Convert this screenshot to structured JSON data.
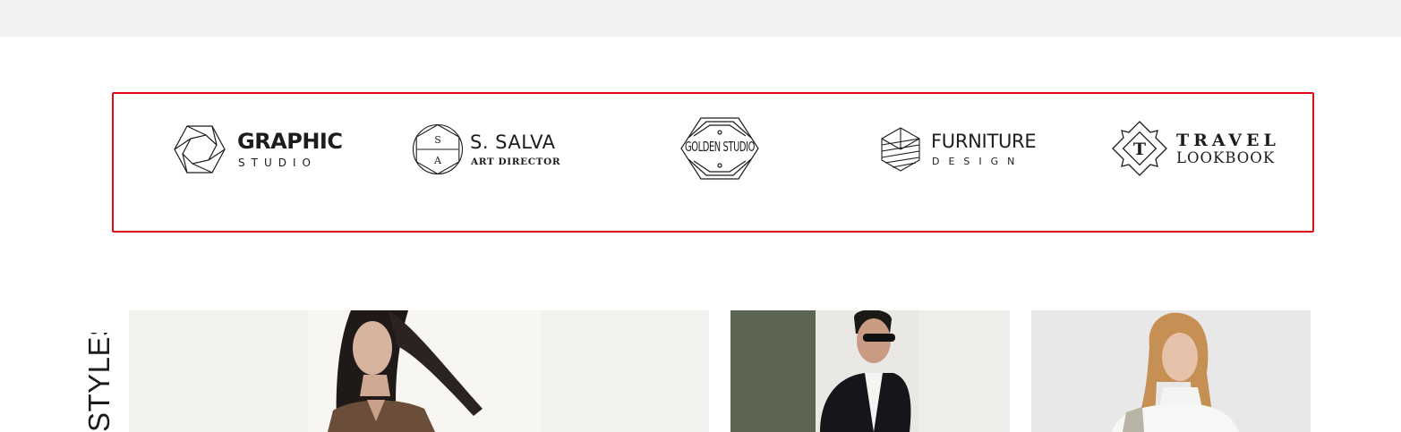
{
  "brands": [
    {
      "line1": "GRAPHIC",
      "line2": "STUDIO",
      "icon": "hexagon-lens-icon"
    },
    {
      "line1": "S. SALVA",
      "line2": "ART DIRECTOR",
      "icon": "monogram-circle-icon",
      "monogram_top": "S",
      "monogram_bottom": "A"
    },
    {
      "line1": "GOLDEN STUDIO",
      "icon": "hexagon-badge-icon"
    },
    {
      "line1": "FURNITURE",
      "line2": "DESIGN",
      "icon": "striped-cube-icon"
    },
    {
      "line1": "TRAVEL",
      "line2": "LOOKBOOK",
      "icon": "diamond-badge-icon",
      "monogram": "T"
    }
  ],
  "section": {
    "heading": "STYLES"
  },
  "photos": [
    {
      "name": "woman-brown-dress"
    },
    {
      "name": "man-black-jacket-sunglasses"
    },
    {
      "name": "woman-white-turtleneck"
    }
  ],
  "colors": {
    "highlight_border": "#e00b14",
    "topbar": "#f1f1f1",
    "ink": "#1c1c1c"
  }
}
